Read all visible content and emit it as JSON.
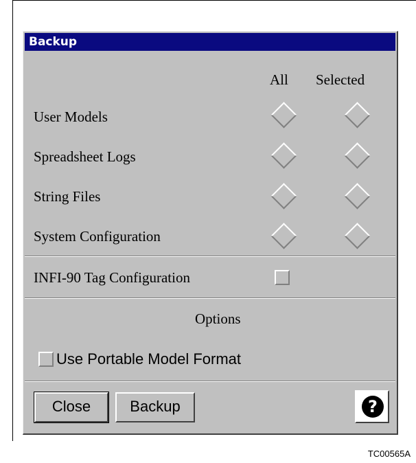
{
  "dialog": {
    "title": "Backup",
    "columns": {
      "all": "All",
      "selected": "Selected"
    },
    "rows": [
      {
        "label": "User Models"
      },
      {
        "label": "Spreadsheet Logs"
      },
      {
        "label": "String Files"
      },
      {
        "label": "System Configuration"
      }
    ],
    "tag_config_label": "INFI-90 Tag Configuration",
    "options_heading": "Options",
    "portable_format_label": "Use Portable Model Format",
    "buttons": {
      "close": "Close",
      "backup": "Backup",
      "help_icon": "?"
    }
  },
  "figure_id": "TC00565A"
}
